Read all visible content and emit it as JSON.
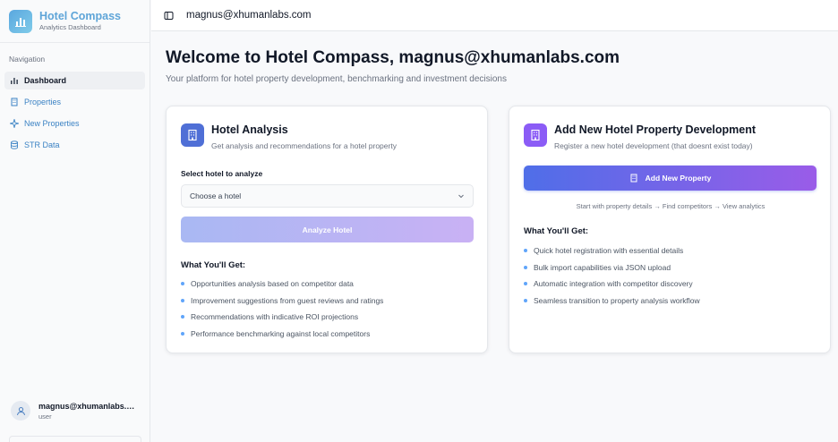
{
  "brand": {
    "title": "Hotel Compass",
    "subtitle": "Analytics Dashboard"
  },
  "sidebar": {
    "heading": "Navigation",
    "items": [
      {
        "label": "Dashboard",
        "icon": "bar-chart-icon",
        "active": true
      },
      {
        "label": "Properties",
        "icon": "building-icon"
      },
      {
        "label": "New Properties",
        "icon": "sparkles-icon"
      },
      {
        "label": "STR Data",
        "icon": "database-icon"
      }
    ],
    "user": {
      "email": "magnus@xhumanlabs.com",
      "role": "user"
    }
  },
  "topbar": {
    "email": "magnus@xhumanlabs.com",
    "toggle_icon": "sidebar-toggle-icon"
  },
  "page": {
    "title": "Welcome to Hotel Compass, magnus@xhumanlabs.com",
    "subtitle": "Your platform for hotel property development, benchmarking and investment decisions"
  },
  "analysis_card": {
    "title": "Hotel Analysis",
    "description": "Get analysis and recommendations for a hotel property",
    "select_label": "Select hotel to analyze",
    "select_value": "Choose a hotel",
    "button_label": "Analyze Hotel",
    "benefits_title": "What You'll Get:",
    "benefits": [
      "Opportunities analysis based on competitor data",
      "Improvement suggestions from guest reviews and ratings",
      "Recommendations with indicative ROI projections",
      "Performance benchmarking against local competitors"
    ]
  },
  "development_card": {
    "title": "Add New Hotel Property Development",
    "description": "Register a new hotel development (that doesnt exist today)",
    "button_label": "Add New Property",
    "flow_text": "Start with property details → Find competitors → View analytics",
    "benefits_title": "What You'll Get:",
    "benefits": [
      "Quick hotel registration with essential details",
      "Bulk import capabilities via JSON upload",
      "Automatic integration with competitor discovery",
      "Seamless transition to property analysis workflow"
    ]
  },
  "colors": {
    "brand": "#5fa5d8",
    "primary_gradient_start": "#4f6ee8",
    "primary_gradient_end": "#9a5ce8",
    "bullet": "#60a5fa"
  }
}
